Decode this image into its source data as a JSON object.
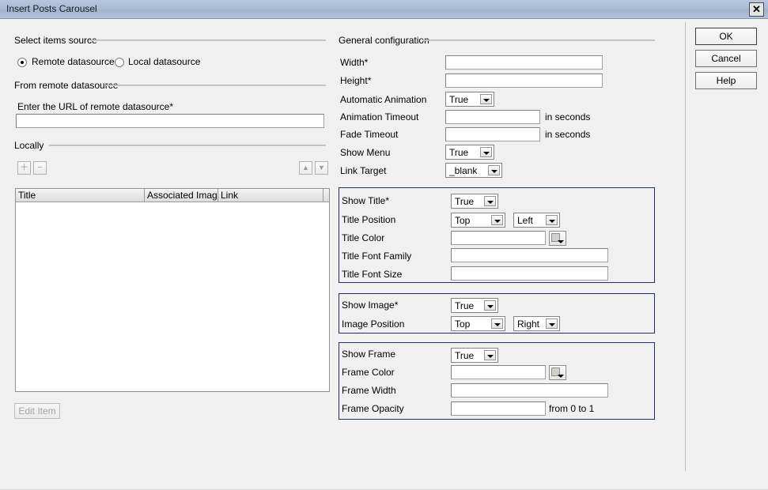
{
  "window": {
    "title": "Insert Posts Carousel",
    "close_icon": "close-icon",
    "close_glyph": "✕"
  },
  "left_panel": {
    "source_group_label": "Select items source",
    "radios": [
      {
        "label": "Remote datasource",
        "checked": true
      },
      {
        "label": "Local datasource",
        "checked": false
      }
    ],
    "remote_group_label": "From remote datasource",
    "url_label": "Enter the URL of remote datasource*",
    "url_value": "",
    "local_group_label": "Locally",
    "toolbar": {
      "add_icon": "plus-icon",
      "add_glyph": "＋",
      "remove_icon": "minus-icon",
      "remove_glyph": "−",
      "move_up_icon": "triangle-up-icon",
      "move_up_glyph": "▲",
      "move_down_icon": "triangle-down-icon",
      "move_down_glyph": "▼"
    },
    "table": {
      "columns": [
        "Title",
        "Associated Image",
        "Link",
        ""
      ],
      "rows": []
    },
    "edit_item_label": "Edit Item",
    "edit_item_enabled": false
  },
  "general": {
    "group_label": "General configuration",
    "fields": {
      "width_label": "Width*",
      "width_value": "",
      "height_label": "Height*",
      "height_value": "",
      "automatic_animation_label": "Automatic Animation",
      "automatic_animation_value": "True",
      "animation_timeout_label": "Animation Timeout",
      "animation_timeout_value": "",
      "animation_timeout_suffix": "in seconds",
      "fade_timeout_label": "Fade Timeout",
      "fade_timeout_value": "",
      "fade_timeout_suffix": "in seconds",
      "show_menu_label": "Show Menu",
      "show_menu_value": "True",
      "link_target_label": "Link Target",
      "link_target_value": "_blank"
    }
  },
  "title_group": {
    "show_title_label": "Show Title*",
    "show_title_value": "True",
    "title_position_label": "Title Position",
    "title_position_vertical": "Top",
    "title_position_horizontal": "Left",
    "title_color_label": "Title Color",
    "title_color_value": "",
    "title_font_family_label": "Title Font Family",
    "title_font_family_value": "",
    "title_font_size_label": "Title Font Size",
    "title_font_size_value": ""
  },
  "image_group": {
    "show_image_label": "Show Image*",
    "show_image_value": "True",
    "image_position_label": "Image Position",
    "image_position_vertical": "Top",
    "image_position_horizontal": "Right"
  },
  "frame_group": {
    "show_frame_label": "Show Frame",
    "show_frame_value": "True",
    "frame_color_label": "Frame Color",
    "frame_color_value": "",
    "frame_width_label": "Frame Width",
    "frame_width_value": "",
    "frame_opacity_label": "Frame Opacity",
    "frame_opacity_value": "",
    "frame_opacity_suffix": "from 0 to 1"
  },
  "buttons": {
    "ok": "OK",
    "cancel": "Cancel",
    "help": "Help"
  },
  "colors": {
    "titlebar": "#a9bcd6",
    "group_border": "#1b2f6e",
    "dialog_bg": "#f0f0f0"
  }
}
